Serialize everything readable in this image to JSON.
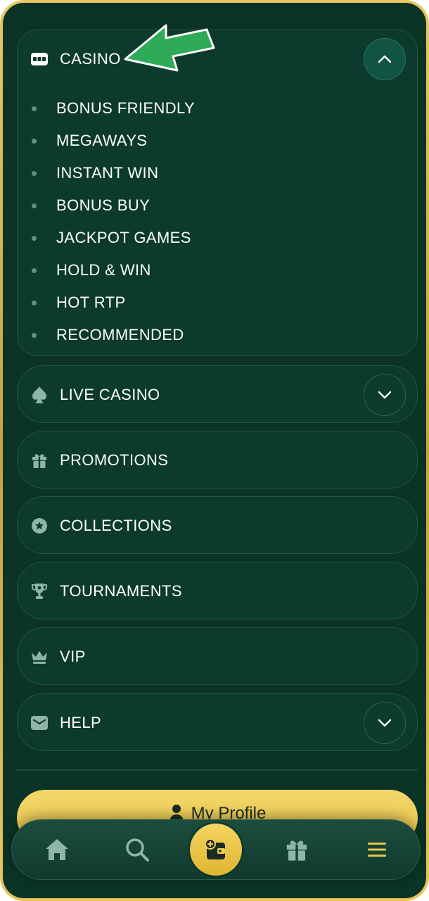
{
  "menu": {
    "casino": {
      "label": "CASINO",
      "items": [
        "BONUS FRIENDLY",
        "MEGAWAYS",
        "INSTANT WIN",
        "BONUS BUY",
        "JACKPOT GAMES",
        "HOLD & WIN",
        "HOT RTP",
        "RECOMMENDED"
      ]
    },
    "live_casino": {
      "label": "LIVE CASINO"
    },
    "promotions": {
      "label": "PROMOTIONS"
    },
    "collections": {
      "label": "COLLECTIONS"
    },
    "tournaments": {
      "label": "TOURNAMENTS"
    },
    "vip": {
      "label": "VIP"
    },
    "help": {
      "label": "HELP"
    }
  },
  "profile_button": {
    "label": "My Profile"
  },
  "icons": {
    "casino": "slot-machine-icon",
    "live_casino": "spade-icon",
    "promotions": "gift-icon",
    "collections": "star-badge-icon",
    "tournaments": "trophy-icon",
    "vip": "crown-icon",
    "help": "mail-icon",
    "nav": [
      "home-icon",
      "search-icon",
      "wallet-add-icon",
      "gift-icon",
      "menu-icon"
    ]
  },
  "colors": {
    "background": "#0b3326",
    "card": "#0c3a2d",
    "accent_gold": "#e8c44a",
    "annotation_arrow": "#2faa57"
  }
}
